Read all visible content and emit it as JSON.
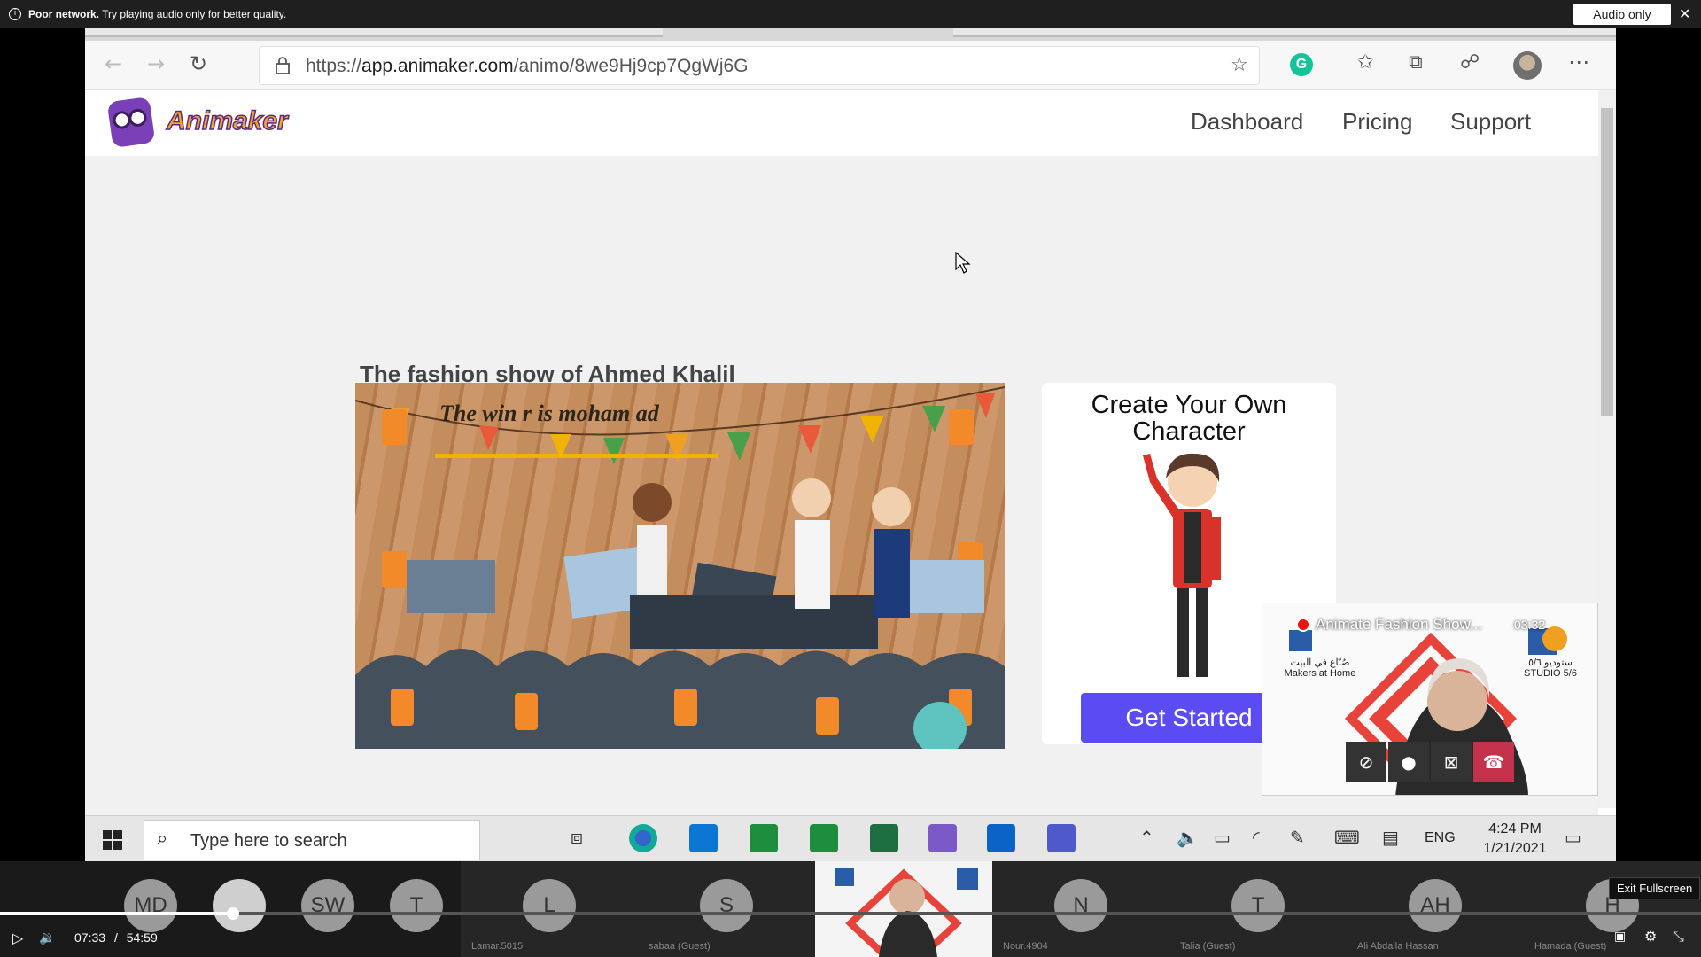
{
  "notice": {
    "bold": "Poor network.",
    "text": " Try playing audio only for better quality.",
    "audio_only_label": "Audio only",
    "close_glyph": "✕"
  },
  "browser": {
    "url_prefix": "https://",
    "url_host": "app.animaker.com",
    "url_path": "/animo/8we9Hj9cp7QgWj6G",
    "grammarly_letter": "G"
  },
  "site": {
    "logo_text": "Animaker",
    "nav": [
      "Dashboard",
      "Pricing",
      "Support"
    ]
  },
  "content": {
    "video_title": "The fashion show of Ahmed Khalil",
    "scene_caption": "The win   r is moham   ad",
    "promo_title_line1": "Create Your Own",
    "promo_title_line2": "Character",
    "cta_label": "Get Started"
  },
  "taskbar": {
    "search_placeholder": "Type here to search",
    "lang": "ENG",
    "time": "4:24 PM",
    "date": "1/21/2021"
  },
  "pip": {
    "title": "Animate Fashion Show...",
    "timer": "03:32",
    "org_left_line1": "صُنّاع في البيت",
    "org_left_line2": "Makers at Home",
    "org_right_line1": "ستوديو ٥/٦",
    "org_right_line2": "STUDIO 5/6"
  },
  "participants": [
    {
      "initials": "MD",
      "name": ""
    },
    {
      "initials": "",
      "name": ""
    },
    {
      "initials": "SW",
      "name": ""
    },
    {
      "initials": "T",
      "name": ""
    },
    {
      "initials": "L",
      "name": "Lamar.5015"
    },
    {
      "initials": "S",
      "name": "sabaa (Guest)"
    },
    {
      "initials": "",
      "name": ""
    },
    {
      "initials": "N",
      "name": "Nour.4904"
    },
    {
      "initials": "T",
      "name": "Talia (Guest)"
    },
    {
      "initials": "AH",
      "name": "Ali Abdalla Hassan"
    },
    {
      "initials": "H",
      "name": "Hamada (Guest)"
    }
  ],
  "player": {
    "current_time": "07:33",
    "separator": "/",
    "duration": "54:59",
    "progress_fraction": 0.137,
    "exit_fullscreen_tooltip": "Exit Fullscreen"
  },
  "colors": {
    "brand_orange": "#f6a623",
    "brand_purple": "#7b3fb8",
    "cta_blue": "#5b4bf2",
    "end_call_red": "#c4314b"
  }
}
